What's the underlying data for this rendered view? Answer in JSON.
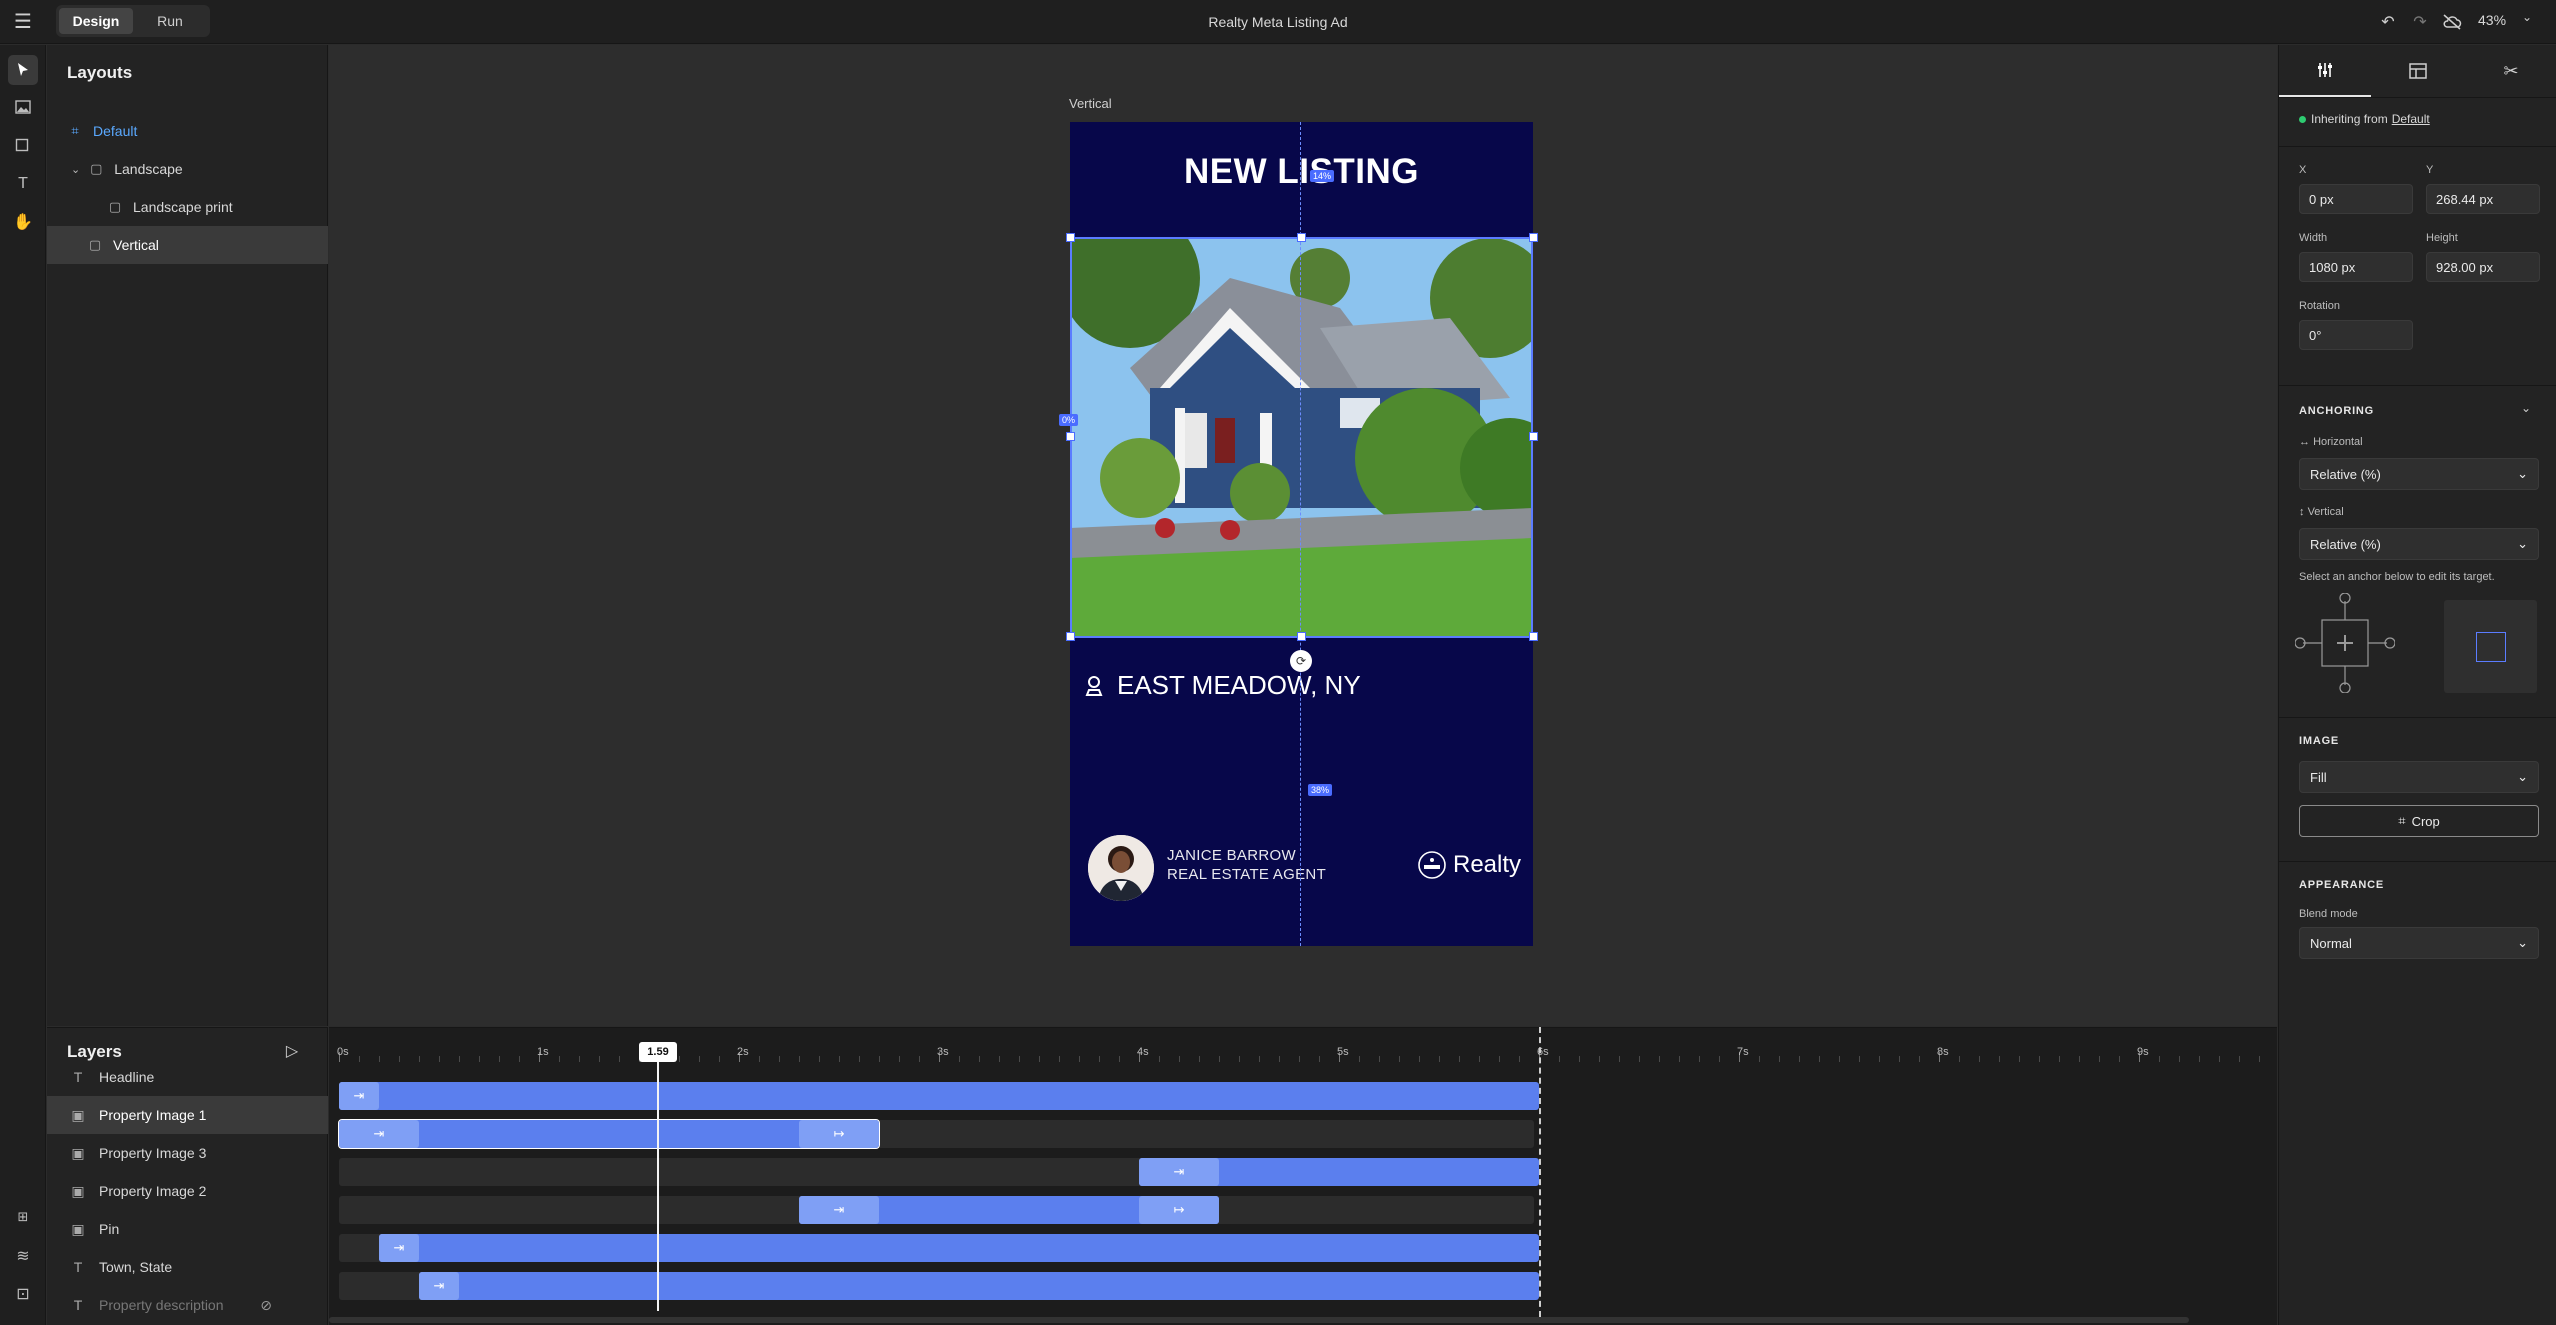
{
  "app": {
    "title": "Realty Meta Listing Ad",
    "modes": [
      "Design",
      "Run"
    ],
    "active_mode": "Design",
    "zoom": "43%"
  },
  "layouts": {
    "title": "Layouts",
    "items": [
      {
        "label": "Default",
        "icon": "frame-icon",
        "active": true
      },
      {
        "label": "Landscape",
        "icon": "layout-icon"
      },
      {
        "label": "Landscape print",
        "icon": "layout-icon"
      },
      {
        "label": "Vertical",
        "icon": "layout-icon",
        "selected": true
      }
    ]
  },
  "canvas": {
    "artboard_label": "Vertical",
    "headline": "NEW LISTING",
    "town": "EAST MEADOW, NY",
    "agent_name": "JANICE BARROW",
    "agent_role": "REAL ESTATE AGENT",
    "logo_text": "Realty",
    "guide_top_pct": "14%",
    "guide_left_pct": "0%",
    "guide_bottom_pct": "38%"
  },
  "inspector": {
    "inherit_prefix": "Inheriting from",
    "inherit_link": "Default",
    "x_label": "X",
    "x_value": "0 px",
    "y_label": "Y",
    "y_value": "268.44 px",
    "width_label": "Width",
    "width_value": "1080 px",
    "height_label": "Height",
    "height_value": "928.00 px",
    "rotation_label": "Rotation",
    "rotation_value": "0°",
    "anchoring_title": "ANCHORING",
    "horizontal_label": "Horizontal",
    "horizontal_value": "Relative (%)",
    "vertical_label": "Vertical",
    "vertical_value": "Relative (%)",
    "anchor_hint": "Select an anchor below to edit its target.",
    "image_title": "IMAGE",
    "image_fit": "Fill",
    "crop_label": "Crop",
    "appearance_title": "APPEARANCE",
    "blend_label": "Blend mode",
    "blend_value": "Normal",
    "accent": "#5b7cff"
  },
  "layers": {
    "title": "Layers",
    "items": [
      {
        "label": "Headline",
        "icon": "text-icon"
      },
      {
        "label": "Property Image 1",
        "icon": "image-icon",
        "selected": true
      },
      {
        "label": "Property Image 3",
        "icon": "image-icon"
      },
      {
        "label": "Property Image 2",
        "icon": "image-icon"
      },
      {
        "label": "Pin",
        "icon": "image-icon"
      },
      {
        "label": "Town, State",
        "icon": "text-icon"
      },
      {
        "label": "Property description",
        "icon": "text-icon",
        "hidden": true
      }
    ]
  },
  "timeline": {
    "tick_labels": [
      "0s",
      "1s",
      "2s",
      "3s",
      "4s",
      "5s",
      "6s",
      "7s",
      "8s",
      "9s"
    ],
    "playhead": "1.59",
    "duration_s": 6,
    "tracks": [
      {
        "start": 0,
        "end": 6,
        "in": [
          0,
          0.2
        ]
      },
      {
        "start": 0,
        "end": 2.7,
        "in": [
          0,
          0.4
        ],
        "out": [
          2.3,
          2.7
        ]
      },
      {
        "start": 4,
        "end": 6,
        "in": [
          4,
          4.4
        ]
      },
      {
        "start": 2.3,
        "end": 4.4,
        "in": [
          2.3,
          2.7
        ],
        "out": [
          4,
          4.4
        ]
      },
      {
        "start": 0.2,
        "end": 6,
        "in": [
          0.2,
          0.4
        ]
      },
      {
        "start": 0.4,
        "end": 6,
        "in": [
          0.4,
          0.6
        ]
      }
    ]
  }
}
